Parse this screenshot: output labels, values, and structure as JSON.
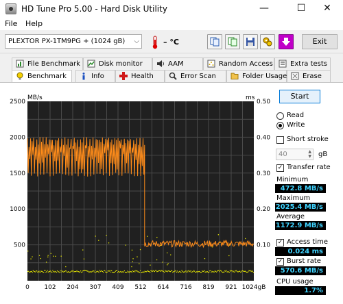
{
  "window": {
    "title": "HD Tune Pro 5.00 - Hard Disk Utility",
    "minimize": "—",
    "maximize": "☐",
    "close": "✕"
  },
  "menu": {
    "file": "File",
    "help": "Help"
  },
  "toolbar": {
    "drive": "PLEXTOR PX-1TM9PG + (1024 gB)",
    "temperature": "– °C",
    "exit_label": "Exit"
  },
  "tabs": [
    {
      "label": "File Benchmark",
      "icon": "file-benchmark-icon"
    },
    {
      "label": "Disk monitor",
      "icon": "disk-monitor-icon"
    },
    {
      "label": "AAM",
      "icon": "speaker-icon"
    },
    {
      "label": "Random Access",
      "icon": "random-access-icon"
    },
    {
      "label": "Extra tests",
      "icon": "extra-tests-icon"
    },
    {
      "label": "Benchmark",
      "icon": "benchmark-icon"
    },
    {
      "label": "Info",
      "icon": "info-icon"
    },
    {
      "label": "Health",
      "icon": "health-cross-icon"
    },
    {
      "label": "Error Scan",
      "icon": "error-scan-icon"
    },
    {
      "label": "Folder Usage",
      "icon": "folder-icon"
    },
    {
      "label": "Erase",
      "icon": "erase-icon"
    }
  ],
  "controls": {
    "start_label": "Start",
    "read_label": "Read",
    "write_label": "Write",
    "mode": "Write",
    "short_stroke_label": "Short stroke",
    "short_stroke_checked": false,
    "stroke_value": "40",
    "stroke_unit": "gB",
    "transfer_rate_label": "Transfer rate",
    "transfer_rate_checked": true,
    "access_time_label": "Access time",
    "access_time_checked": true,
    "burst_rate_label": "Burst rate",
    "burst_rate_checked": true
  },
  "stats": {
    "minimum_label": "Minimum",
    "minimum": "472.8 MB/s",
    "maximum_label": "Maximum",
    "maximum": "2025.4 MB/s",
    "average_label": "Average",
    "average": "1172.9 MB/s",
    "access_time": "0.024 ms",
    "burst_rate": "570.6 MB/s",
    "cpu_label": "CPU usage",
    "cpu_usage": "1.7%"
  },
  "colors": {
    "transfer_line": "#ff8c1a",
    "access_dots": "#e8e800",
    "graph_bg": "#202020",
    "grid": "#4a4a4a",
    "stat_bg": "#000000",
    "stat_text": "#3fd3ff"
  },
  "chart_data": {
    "type": "line",
    "y_left_label": "MB/s",
    "y_right_label": "ms",
    "y_left_ticks": [
      "2500",
      "2000",
      "1500",
      "1000",
      "500"
    ],
    "y_right_ticks": [
      "0.50",
      "0.40",
      "0.30",
      "0.20",
      "0.10"
    ],
    "x_ticks": [
      "0",
      "102",
      "204",
      "307",
      "409",
      "512",
      "614",
      "716",
      "819",
      "921",
      "1024gB"
    ],
    "ylim_left": [
      0,
      2500
    ],
    "ylim_right": [
      0,
      0.5
    ],
    "xlim": [
      0,
      1024
    ],
    "series": [
      {
        "name": "Transfer rate",
        "segments": [
          {
            "x_range": [
              0,
              530
            ],
            "band_low": 1450,
            "band_high": 2000,
            "baseline": 1850
          },
          {
            "x_range": [
              530,
              1024
            ],
            "band_low": 470,
            "band_high": 560,
            "baseline": 510
          }
        ]
      },
      {
        "name": "Access time",
        "typical_ms": 0.024
      }
    ]
  }
}
